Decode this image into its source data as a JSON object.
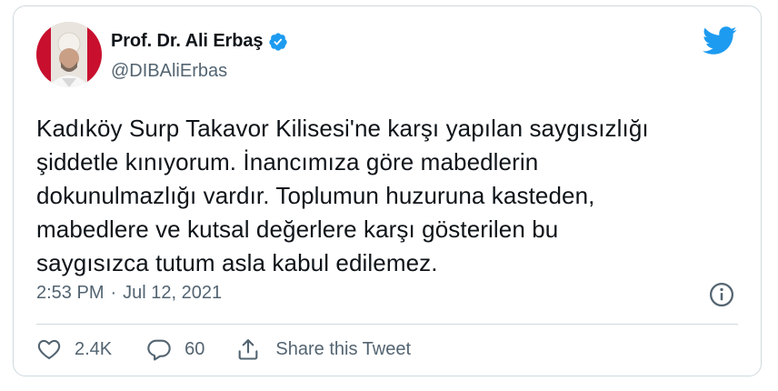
{
  "author": {
    "display_name": "Prof. Dr. Ali Erbaş",
    "handle": "@DIBAliErbas"
  },
  "tweet": {
    "text": "Kadıköy Surp Takavor Kilisesi'ne karşı yapılan saygısızlığı\nşiddetle kınıyorum. İnancımıza göre mabedlerin\ndokunulmazlığı vardır. Toplumun huzuruna kasteden,\nmabedlere ve kutsal değerlere karşı gösterilen bu\nsaygısızca tutum asla kabul edilemez.",
    "time": "2:53 PM",
    "separator": "·",
    "date": "Jul 12, 2021"
  },
  "actions": {
    "likes": "2.4K",
    "replies": "60",
    "share_label": "Share this Tweet"
  },
  "icons": {
    "verified": "verified-badge-icon",
    "brand": "twitter-bird-icon",
    "info": "info-icon",
    "like": "heart-icon",
    "reply": "reply-bubble-icon",
    "share": "share-icon"
  },
  "colors": {
    "twitter_blue": "#1d9bf0",
    "text_primary": "#0f1419",
    "text_secondary": "#536471",
    "border": "#cfd9de"
  }
}
